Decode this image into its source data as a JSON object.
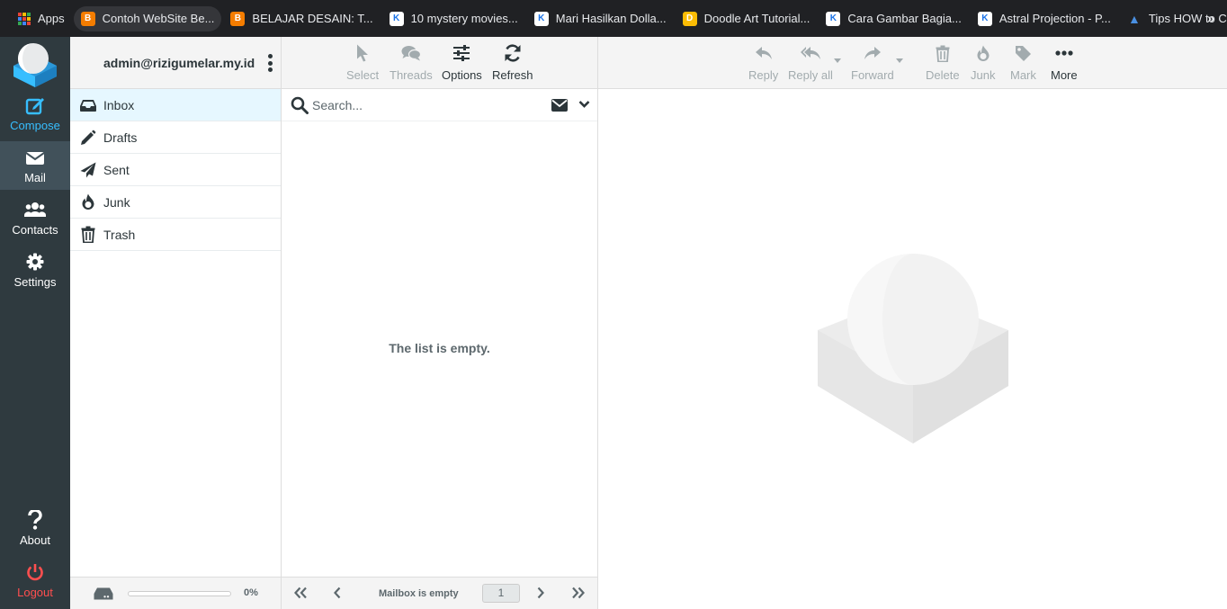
{
  "bookmarks": {
    "apps_label": "Apps",
    "items": [
      {
        "label": "Contoh WebSite Be...",
        "icon": "blogger-icon"
      },
      {
        "label": "BELAJAR DESAIN: T...",
        "icon": "blogger-icon"
      },
      {
        "label": "10 mystery movies...",
        "icon": "k-icon"
      },
      {
        "label": "Mari Hasilkan Dolla...",
        "icon": "k-icon"
      },
      {
        "label": "Doodle Art Tutorial...",
        "icon": "doodle-icon"
      },
      {
        "label": "Cara Gambar Bagia...",
        "icon": "k-icon"
      },
      {
        "label": "Astral Projection - P...",
        "icon": "k-icon"
      },
      {
        "label": "Tips HOW to CREAT...",
        "icon": "triangle-icon"
      }
    ],
    "more": "»"
  },
  "rail": {
    "compose": "Compose",
    "mail": "Mail",
    "contacts": "Contacts",
    "settings": "Settings",
    "about": "About",
    "logout": "Logout"
  },
  "account": {
    "email": "admin@rizigumelar.my.id"
  },
  "folders": [
    {
      "label": "Inbox",
      "icon": "inbox-icon"
    },
    {
      "label": "Drafts",
      "icon": "pencil-icon"
    },
    {
      "label": "Sent",
      "icon": "paper-plane-icon"
    },
    {
      "label": "Junk",
      "icon": "fire-icon"
    },
    {
      "label": "Trash",
      "icon": "trash-icon"
    }
  ],
  "quota": {
    "percent": "0%",
    "used_fraction": 0
  },
  "list_toolbar": {
    "select": "Select",
    "threads": "Threads",
    "options": "Options",
    "refresh": "Refresh"
  },
  "search": {
    "placeholder": "Search..."
  },
  "list": {
    "empty_text": "The list is empty."
  },
  "pager": {
    "info": "Mailbox is empty",
    "page": "1"
  },
  "message_toolbar": {
    "reply": "Reply",
    "reply_all": "Reply all",
    "forward": "Forward",
    "delete": "Delete",
    "junk": "Junk",
    "mark": "Mark",
    "more": "More"
  },
  "colors": {
    "accent": "#37beff",
    "rail_bg": "#2f3a3f",
    "logout": "#ff4f4f",
    "selected_folder": "#e6f7ff"
  }
}
